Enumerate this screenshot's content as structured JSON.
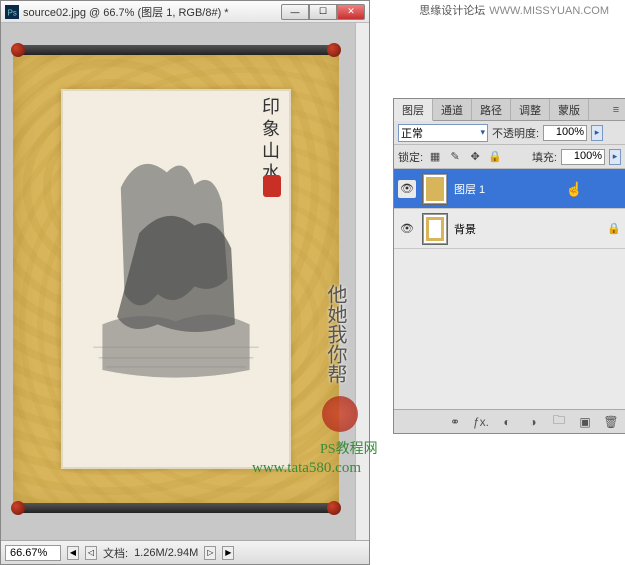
{
  "watermark": {
    "forum": "思缘设计论坛",
    "forum_url": "WWW.MISSYUAN.COM",
    "vertical": "他她我你帮",
    "text1": "PS教程网",
    "url": "www.tata580.com"
  },
  "doc": {
    "icon_alt": "ps-doc",
    "title": "source02.jpg @ 66.7% (图层 1, RGB/8#) *",
    "zoom": "66.67%",
    "docinfo_label": "文档:",
    "docinfo": "1.26M/2.94M"
  },
  "painting": {
    "calligraphy": "印象山水"
  },
  "panel": {
    "tabs": [
      "图层",
      "通道",
      "路径",
      "调整",
      "蒙版"
    ],
    "blend_mode": "正常",
    "opacity_label": "不透明度:",
    "opacity": "100%",
    "lock_label": "锁定:",
    "fill_label": "填充:",
    "fill": "100%",
    "layers": [
      {
        "name": "图层 1",
        "visible": true,
        "selected": true,
        "locked": false
      },
      {
        "name": "背景",
        "visible": true,
        "selected": false,
        "locked": true
      }
    ]
  }
}
